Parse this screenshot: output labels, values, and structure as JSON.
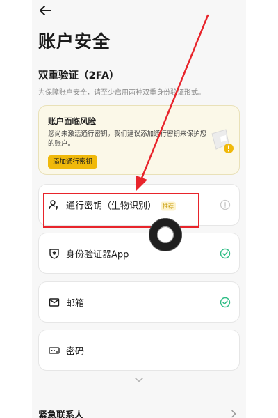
{
  "header": {
    "title": "账户安全"
  },
  "two_factor": {
    "title": "双重验证（2FA）",
    "description": "为保障账户安全，请至少启用两种双重身份验证形式。"
  },
  "risk_card": {
    "title": "账户面临风险",
    "text": "您尚未激活通行密钥。我们建议添加通行密钥来保护您的账户。",
    "button_label": "添加通行密钥"
  },
  "methods": [
    {
      "label": "通行密钥（生物识别）",
      "badge": "推荐",
      "icon": "user-passkey-icon",
      "status": "info-icon"
    },
    {
      "label": "身份验证器App",
      "icon": "authenticator-shield-icon",
      "status": "check-icon"
    },
    {
      "label": "邮箱",
      "icon": "mail-icon",
      "status": "check-icon"
    },
    {
      "label": "密码",
      "icon": "password-icon",
      "status": ""
    }
  ],
  "emergency": {
    "label": "紧急联系人"
  },
  "colors": {
    "accent": "#f0b90b",
    "success": "#2ebd85",
    "annotation": "#e8242b"
  }
}
